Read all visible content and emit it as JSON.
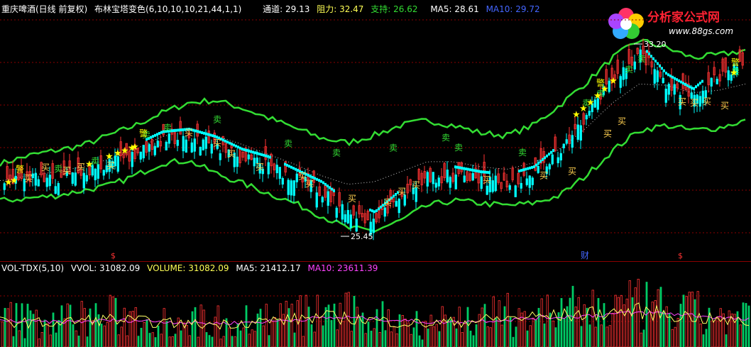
{
  "main_header": {
    "stock_label": "重庆啤酒(日线 前复权)",
    "indicator_label": "布林宝塔变色(6,10,10,10,21,44,1,1)",
    "channel_label": "通道: 29.13",
    "resistance_label": "阻力: 32.47",
    "support_label": "支持: 26.62",
    "ma5_label": "MA5: 28.61",
    "ma10_label": "MA10: 29.72"
  },
  "sub_header": {
    "indicator_label": "VOL-TDX(5,10)",
    "vvol_label": "VVOL: 31082.09",
    "volume_label": "VOLUME: 31082.09",
    "ma5_label": "MA5: 21412.17",
    "ma10_label": "MA10: 23611.39"
  },
  "logo": {
    "title": "分析家公式网",
    "url": "www.88gs.com"
  },
  "annotations": {
    "high": "33.20",
    "low": "25.45",
    "buy": "买",
    "sell": "卖",
    "warn": "警",
    "finance": "财",
    "dollar": "$"
  },
  "colors": {
    "bg": "#000000",
    "grid": "#8b0000",
    "band": "#33dd33",
    "up": "#ff3333",
    "down": "#00ffff",
    "buy_text": "#ffd050",
    "sell_text": "#33dd33",
    "star": "#ffff00",
    "mid_dots": "#cccccc",
    "ma5": "#ffff66",
    "ma10": "#ff44ff",
    "vol_up": "#ff3333",
    "vol_down": "#00cc66",
    "white": "#ffffff",
    "magenta": "#ff44ff",
    "blue": "#4466ff"
  },
  "chart_data": {
    "type": "bar",
    "price_range": [
      25.45,
      33.2
    ],
    "upper_band": [
      28.4,
      28.7,
      28.9,
      29.1,
      29.5,
      29.9,
      30.4,
      30.8,
      30.9,
      30.6,
      30.2,
      29.8,
      29.4,
      29.2,
      29.5,
      29.9,
      30.1,
      29.9,
      29.6,
      29.5,
      29.9,
      30.7,
      31.6,
      32.6,
      33.3,
      33.0,
      32.6,
      32.7,
      32.9
    ],
    "lower_band": [
      26.9,
      27.0,
      27.1,
      27.3,
      27.5,
      27.9,
      28.4,
      28.5,
      28.0,
      27.6,
      27.2,
      26.8,
      26.3,
      25.8,
      25.7,
      26.1,
      26.7,
      26.9,
      26.8,
      26.7,
      26.8,
      27.1,
      27.9,
      28.9,
      29.7,
      29.9,
      29.7,
      29.8,
      30.1
    ],
    "price": [
      27.6,
      27.8,
      27.7,
      28.0,
      28.4,
      28.8,
      29.3,
      29.4,
      29.1,
      28.6,
      28.3,
      27.8,
      27.3,
      26.5,
      26.1,
      27.0,
      27.8,
      27.9,
      27.7,
      27.6,
      27.9,
      28.8,
      30.3,
      31.7,
      32.8,
      31.6,
      31.0,
      31.9,
      32.4
    ],
    "volume_ma5": [
      22000,
      21000,
      20500,
      23000,
      24000,
      22500,
      21000,
      20000,
      19500,
      21000,
      22500,
      24000,
      26000,
      25000,
      23000,
      21000,
      20000,
      21500,
      23000,
      24500,
      26000,
      27000,
      28500,
      30000,
      31082,
      28000,
      26000,
      23000,
      21412
    ],
    "volume_ma10": [
      22500,
      22000,
      21500,
      22000,
      23000,
      23000,
      22000,
      21000,
      20500,
      21000,
      22000,
      23500,
      25000,
      25500,
      24500,
      23000,
      21500,
      21500,
      22500,
      23500,
      25000,
      26000,
      27000,
      28500,
      29500,
      29000,
      27500,
      25500,
      23611
    ]
  }
}
